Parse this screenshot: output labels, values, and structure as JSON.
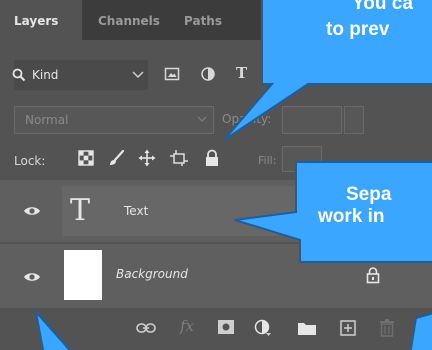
{
  "tabs": [
    {
      "label": "Layers"
    },
    {
      "label": "Channels"
    },
    {
      "label": "Paths"
    }
  ],
  "filter": {
    "kind_label": "Kind"
  },
  "blend": {
    "mode": "Normal",
    "opacity_label": "Opacity:"
  },
  "lock": {
    "label": "Lock:",
    "fill_label": "Fill:"
  },
  "layers": [
    {
      "name": "Text"
    },
    {
      "name": "Background"
    }
  ],
  "callouts": {
    "top_line1": "You ca",
    "top_line2": "to prev",
    "mid_line1": "Sepa",
    "mid_line2": "work in"
  },
  "colors": {
    "panel_bg": "#535353",
    "callout_fill": "#3aa6ff",
    "callout_stroke": "#1d5f9c"
  },
  "icons": {
    "search": "search-icon",
    "image_filter": "image-filter-icon",
    "adjustment_filter": "adjustment-filter-icon",
    "type_filter": "type-filter-icon",
    "lock_transparent": "lock-transparent-pixels-icon",
    "lock_paint": "lock-image-pixels-icon",
    "lock_move": "lock-position-icon",
    "lock_artboard": "lock-artboard-icon",
    "lock_all": "lock-all-icon",
    "eye": "eye-icon",
    "type_thumb": "type-layer-icon",
    "padlock": "padlock-icon",
    "link": "link-layers-icon",
    "fx": "fx-icon",
    "mask": "add-mask-icon",
    "adjustment": "new-adjustment-icon",
    "folder": "new-group-icon",
    "new_layer": "new-layer-icon",
    "trash": "delete-layer-icon"
  }
}
